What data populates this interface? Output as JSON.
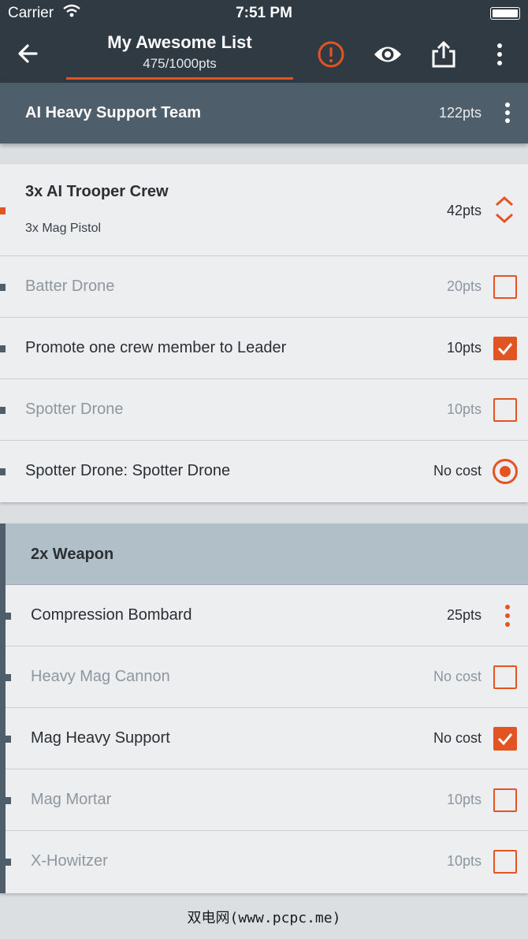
{
  "status_bar": {
    "carrier": "Carrier",
    "time": "7:51 PM"
  },
  "app_bar": {
    "title": "My Awesome List",
    "subtitle": "475/1000pts",
    "icons": [
      "back-arrow-icon",
      "warning-icon",
      "eye-icon",
      "share-icon",
      "more-vertical-icon"
    ]
  },
  "unit_header": {
    "name": "AI Heavy Support Team",
    "points": "122pts"
  },
  "card_one": {
    "unit": {
      "title": "3x AI Trooper Crew",
      "subtitle": "3x Mag Pistol",
      "cost": "42pts"
    },
    "options": [
      {
        "label": "Batter Drone",
        "cost": "20pts",
        "control": "checkbox",
        "checked": false,
        "enabled": false
      },
      {
        "label": "Promote one crew member to Leader",
        "cost": "10pts",
        "control": "checkbox",
        "checked": true,
        "enabled": true
      },
      {
        "label": "Spotter Drone",
        "cost": "10pts",
        "control": "checkbox",
        "checked": false,
        "enabled": false
      },
      {
        "label": "Spotter Drone: Spotter Drone",
        "cost": "No cost",
        "control": "radio",
        "checked": true,
        "enabled": true
      }
    ]
  },
  "card_two": {
    "group_title": "2x Weapon",
    "options": [
      {
        "label": "Compression Bombard",
        "cost": "25pts",
        "control": "menu",
        "enabled": true
      },
      {
        "label": "Heavy Mag Cannon",
        "cost": "No cost",
        "control": "checkbox",
        "checked": false,
        "enabled": false
      },
      {
        "label": "Mag Heavy Support",
        "cost": "No cost",
        "control": "checkbox",
        "checked": true,
        "enabled": true
      },
      {
        "label": "Mag Mortar",
        "cost": "10pts",
        "control": "checkbox",
        "checked": false,
        "enabled": false
      },
      {
        "label": "X-Howitzer",
        "cost": "10pts",
        "control": "checkbox",
        "checked": false,
        "enabled": false
      }
    ]
  },
  "watermark": "双电网(www.pcpc.me)",
  "colors": {
    "app_bar": "#2f3a42",
    "header": "#4e5e6a",
    "accent": "#e25422",
    "group_header": "#b1bfc8"
  }
}
